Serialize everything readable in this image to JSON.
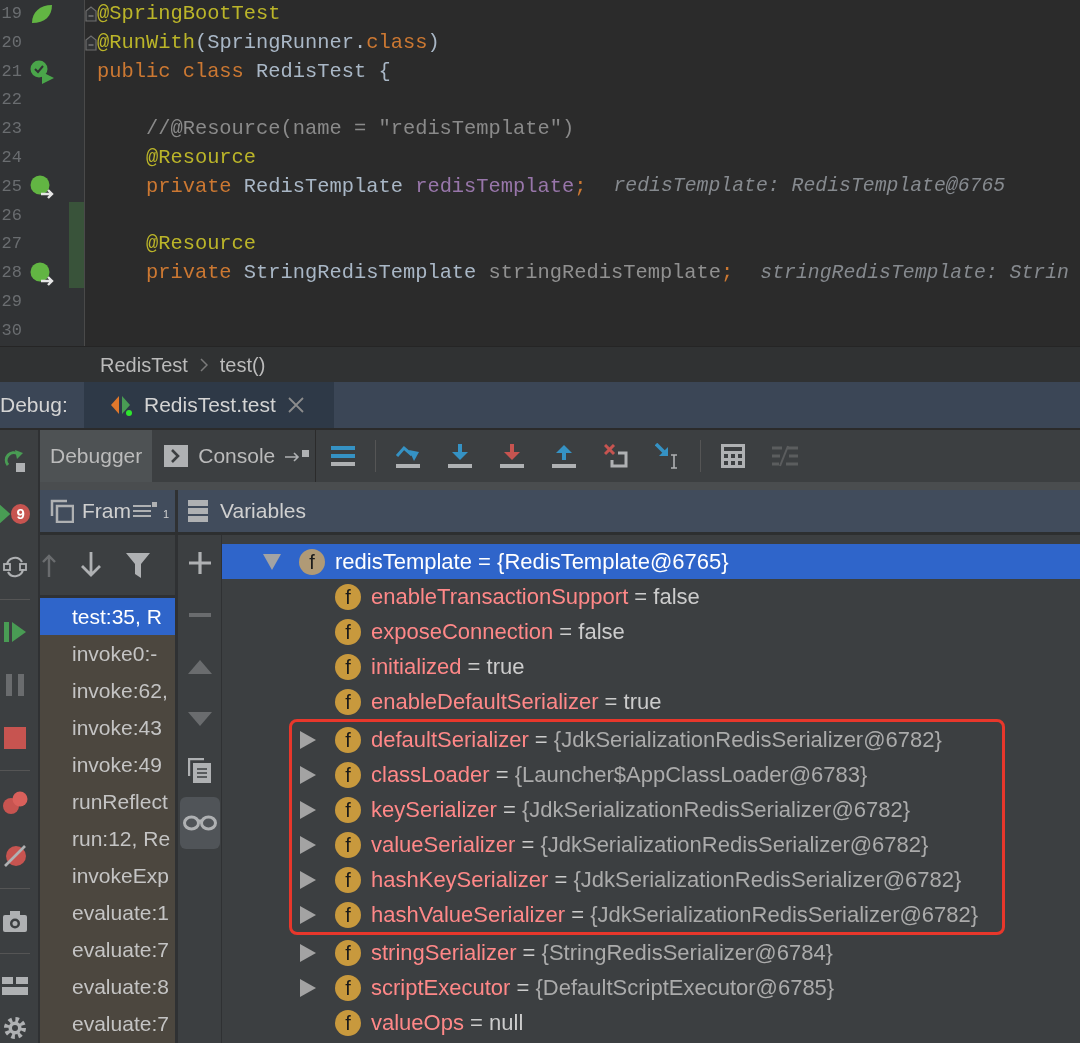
{
  "editor": {
    "lines": [
      {
        "number": "19",
        "gutter_icon": {
          "kind": "leaf"
        },
        "fold": true,
        "changed": false,
        "tokens": [
          {
            "kind": "annotation",
            "text": "@SpringBootTest"
          }
        ]
      },
      {
        "number": "20",
        "fold": true,
        "changed": false,
        "tokens": [
          {
            "kind": "annotation",
            "text": "@RunWith"
          },
          {
            "kind": "plain",
            "text": "(SpringRunner."
          },
          {
            "kind": "keyword",
            "text": "class"
          },
          {
            "kind": "plain",
            "text": ")"
          }
        ]
      },
      {
        "number": "21",
        "gutter_icon": {
          "kind": "run"
        },
        "fold": false,
        "changed": false,
        "tokens": [
          {
            "kind": "keyword",
            "text": "public class "
          },
          {
            "kind": "plain",
            "text": "RedisTest {"
          }
        ]
      },
      {
        "number": "22",
        "fold": false,
        "changed": false
      },
      {
        "number": "23",
        "fold": false,
        "changed": false,
        "tokens": [
          {
            "kind": "comment",
            "text": "    //@Resource(name = \"redisTemplate\")"
          }
        ]
      },
      {
        "number": "24",
        "fold": false,
        "changed": false,
        "tokens": [
          {
            "kind": "annotation",
            "text": "    @Resource"
          }
        ]
      },
      {
        "number": "25",
        "gutter_icon": {
          "kind": "bean"
        },
        "fold": false,
        "changed": false,
        "tokens": [
          {
            "kind": "keyword",
            "text": "    private "
          },
          {
            "kind": "plain",
            "text": "RedisTemplate "
          },
          {
            "kind": "field",
            "text": "redisTemplate"
          },
          {
            "kind": "keyword",
            "text": ";"
          }
        ],
        "hint": "redisTemplate: RedisTemplate@6765"
      },
      {
        "number": "26",
        "fold": false,
        "changed": true
      },
      {
        "number": "27",
        "fold": false,
        "changed": true,
        "tokens": [
          {
            "kind": "annotation",
            "text": "    @Resource"
          }
        ]
      },
      {
        "number": "28",
        "gutter_icon": {
          "kind": "bean"
        },
        "fold": false,
        "changed": true,
        "tokens": [
          {
            "kind": "keyword",
            "text": "    private "
          },
          {
            "kind": "plain",
            "text": "StringRedisTemplate "
          },
          {
            "kind": "unused",
            "text": "stringRedisTemplate"
          },
          {
            "kind": "keyword",
            "text": ";"
          }
        ],
        "hint": "stringRedisTemplate: Strin"
      },
      {
        "number": "29",
        "fold": false,
        "changed": false
      },
      {
        "number": "30",
        "fold": false,
        "changed": false
      }
    ]
  },
  "breadcrumbs": [
    {
      "label": "RedisTest"
    },
    {
      "label": "test()"
    }
  ],
  "debug_window": {
    "label": "Debug:",
    "tabs": [
      {
        "title": "RedisTest.test",
        "selected": true
      }
    ]
  },
  "left_toolbar": [
    {
      "kind": "rerun",
      "disabled": false
    },
    {
      "kind": "rerunfailed",
      "badge": "9",
      "disabled": false
    },
    {
      "kind": "restore",
      "disabled": false
    },
    {
      "kind": "separator"
    },
    {
      "kind": "resume",
      "disabled": false
    },
    {
      "kind": "pause",
      "disabled": true
    },
    {
      "kind": "stop",
      "disabled": false
    },
    {
      "kind": "separator"
    },
    {
      "kind": "breakpoints",
      "disabled": false
    },
    {
      "kind": "mute",
      "disabled": false
    },
    {
      "kind": "separator"
    },
    {
      "kind": "camera",
      "disabled": false
    },
    {
      "kind": "separator"
    },
    {
      "kind": "layout",
      "disabled": false
    },
    {
      "kind": "settings",
      "disabled": false
    }
  ],
  "tool_tabs": [
    {
      "kind": "debugger",
      "label": "Debugger",
      "selected": true
    },
    {
      "kind": "console",
      "label": "Console",
      "selected": false
    }
  ],
  "toolbar": [
    {
      "kind": "executionpoint",
      "disabled": false
    },
    {
      "kind": "separator"
    },
    {
      "kind": "stepover",
      "disabled": false
    },
    {
      "kind": "stepinto",
      "disabled": false
    },
    {
      "kind": "forcestepinto",
      "disabled": false
    },
    {
      "kind": "stepout",
      "disabled": false
    },
    {
      "kind": "dropframe",
      "disabled": false
    },
    {
      "kind": "runtocursor",
      "disabled": false
    },
    {
      "kind": "separator"
    },
    {
      "kind": "evaluate",
      "disabled": false
    },
    {
      "kind": "trace",
      "disabled": true
    }
  ],
  "frames": {
    "title": "Fram",
    "badge": "1",
    "toolbar": [
      {
        "kind": "up",
        "disabled": true
      },
      {
        "kind": "down",
        "disabled": false
      },
      {
        "kind": "filter",
        "disabled": false
      }
    ],
    "items": [
      {
        "text": "test:35, R",
        "selected": true
      },
      {
        "text": "invoke0:-",
        "selected": false
      },
      {
        "text": "invoke:62,",
        "selected": false
      },
      {
        "text": "invoke:43",
        "selected": false
      },
      {
        "text": "invoke:49",
        "selected": false
      },
      {
        "text": "runReflect",
        "selected": false
      },
      {
        "text": "run:12, Re",
        "selected": false
      },
      {
        "text": "invokeExp",
        "selected": false
      },
      {
        "text": "evaluate:1",
        "selected": false
      },
      {
        "text": "evaluate:7",
        "selected": false
      },
      {
        "text": "evaluate:8",
        "selected": false
      },
      {
        "text": "evaluate:7",
        "selected": false
      }
    ]
  },
  "variables": {
    "title": "Variables",
    "toolbar": [
      {
        "kind": "add",
        "disabled": false,
        "on": false
      },
      {
        "kind": "remove",
        "disabled": true,
        "on": false
      },
      {
        "kind": "up",
        "disabled": true,
        "on": false
      },
      {
        "kind": "down",
        "disabled": true,
        "on": false
      },
      {
        "kind": "copy",
        "disabled": false,
        "on": false
      },
      {
        "kind": "watches",
        "disabled": false,
        "on": true
      }
    ],
    "tree": [
      {
        "badge": "f",
        "name": "redisTemplate",
        "sep": "=",
        "value": "{RedisTemplate@6765}",
        "kind": "object",
        "expanded": true,
        "selected": true,
        "highlighted": false,
        "children": [
          {
            "badge": "f",
            "name": "enableTransactionSupport",
            "sep": "=",
            "value": "false",
            "kind": "primitive",
            "selected": false,
            "highlighted": false
          },
          {
            "badge": "f",
            "name": "exposeConnection",
            "sep": "=",
            "value": "false",
            "kind": "primitive",
            "selected": false,
            "highlighted": false
          },
          {
            "badge": "f",
            "name": "initialized",
            "sep": "=",
            "value": "true",
            "kind": "primitive",
            "selected": false,
            "highlighted": false
          },
          {
            "badge": "f",
            "name": "enableDefaultSerializer",
            "sep": "=",
            "value": "true",
            "kind": "primitive",
            "selected": false,
            "highlighted": false
          },
          {
            "badge": "f",
            "name": "defaultSerializer",
            "sep": "=",
            "value": "{JdkSerializationRedisSerializer@6782}",
            "kind": "object",
            "expanded": false,
            "selected": false,
            "highlighted": true
          },
          {
            "badge": "f",
            "name": "classLoader",
            "sep": "=",
            "value": "{Launcher$AppClassLoader@6783}",
            "kind": "object",
            "expanded": false,
            "selected": false,
            "highlighted": true
          },
          {
            "badge": "f",
            "name": "keySerializer",
            "sep": "=",
            "value": "{JdkSerializationRedisSerializer@6782}",
            "kind": "object",
            "expanded": false,
            "selected": false,
            "highlighted": true
          },
          {
            "badge": "f",
            "name": "valueSerializer",
            "sep": "=",
            "value": "{JdkSerializationRedisSerializer@6782}",
            "kind": "object",
            "expanded": false,
            "selected": false,
            "highlighted": true
          },
          {
            "badge": "f",
            "name": "hashKeySerializer",
            "sep": "=",
            "value": "{JdkSerializationRedisSerializer@6782}",
            "kind": "object",
            "expanded": false,
            "selected": false,
            "highlighted": true
          },
          {
            "badge": "f",
            "name": "hashValueSerializer",
            "sep": "=",
            "value": "{JdkSerializationRedisSerializer@6782}",
            "kind": "object",
            "expanded": false,
            "selected": false,
            "highlighted": true
          },
          {
            "badge": "f",
            "name": "stringSerializer",
            "sep": "=",
            "value": "{StringRedisSerializer@6784}",
            "kind": "object",
            "expanded": false,
            "selected": false,
            "highlighted": false
          },
          {
            "badge": "f",
            "name": "scriptExecutor",
            "sep": "=",
            "value": "{DefaultScriptExecutor@6785}",
            "kind": "object",
            "expanded": false,
            "selected": false,
            "highlighted": false
          },
          {
            "badge": "f",
            "name": "valueOps",
            "sep": "=",
            "value": "null",
            "kind": "primitive",
            "selected": false,
            "highlighted": false
          }
        ]
      }
    ]
  }
}
